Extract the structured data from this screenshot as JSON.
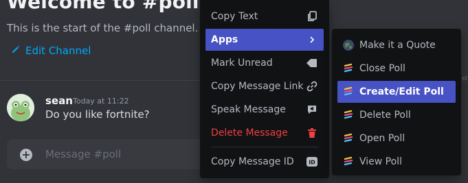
{
  "channel": {
    "welcome_title": "Welcome to #poll!",
    "welcome_subtitle": "This is the start of the #poll channel.",
    "edit_channel_label": "Edit Channel"
  },
  "message": {
    "author": "sean",
    "timestamp": "Today at 11:22",
    "content": "Do you like fortnite?"
  },
  "composer": {
    "placeholder": "Message #poll"
  },
  "context_menu": {
    "items": [
      {
        "label": "Copy Text",
        "icon": "copy-icon"
      },
      {
        "label": "Apps",
        "icon": "chevron-right-icon"
      },
      {
        "label": "Mark Unread",
        "icon": "mark-unread-icon"
      },
      {
        "label": "Copy Message Link",
        "icon": "link-icon"
      },
      {
        "label": "Speak Message",
        "icon": "speak-icon"
      },
      {
        "label": "Delete Message",
        "icon": "trash-icon"
      },
      {
        "label": "Copy Message ID",
        "icon": "id-icon"
      }
    ]
  },
  "apps_submenu": {
    "items": [
      {
        "label": "Make it a Quote",
        "icon": "globe-app-icon"
      },
      {
        "label": "Close Poll",
        "icon": "poll-app-icon"
      },
      {
        "label": "Create/Edit Poll",
        "icon": "poll-app-icon"
      },
      {
        "label": "Delete Poll",
        "icon": "poll-app-icon"
      },
      {
        "label": "Open Poll",
        "icon": "poll-app-icon"
      },
      {
        "label": "View Poll",
        "icon": "poll-app-icon"
      }
    ]
  },
  "colors": {
    "background": "#313338",
    "menu_background": "#111214",
    "accent": "#4752c4",
    "danger": "#f23f42",
    "link": "#00a8fc"
  }
}
